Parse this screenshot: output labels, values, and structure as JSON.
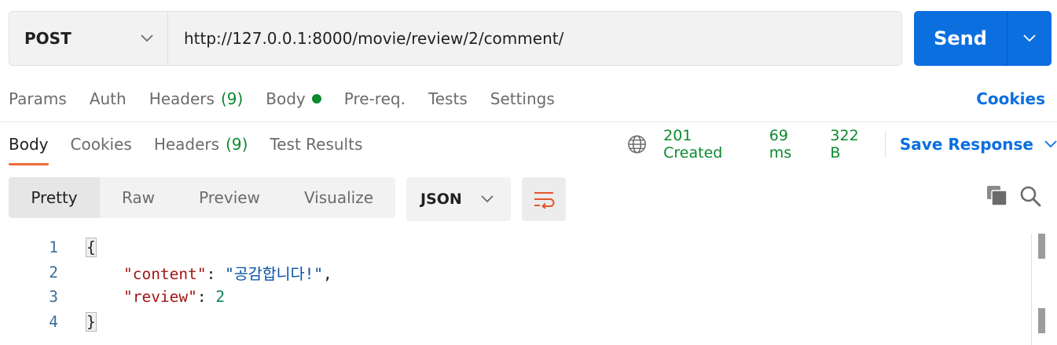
{
  "request": {
    "method": "POST",
    "url": "http://127.0.0.1:8000/movie/review/2/comment/",
    "send_label": "Send"
  },
  "request_tabs": {
    "params": "Params",
    "auth": "Auth",
    "headers": "Headers",
    "headers_count": "(9)",
    "body": "Body",
    "prereq": "Pre-req.",
    "tests": "Tests",
    "settings": "Settings",
    "cookies": "Cookies"
  },
  "response_tabs": {
    "body": "Body",
    "cookies": "Cookies",
    "headers": "Headers",
    "headers_count": "(9)",
    "test_results": "Test Results"
  },
  "status": {
    "code_text": "201 Created",
    "time": "69 ms",
    "size": "322 B",
    "save_response": "Save Response"
  },
  "format": {
    "pretty": "Pretty",
    "raw": "Raw",
    "preview": "Preview",
    "visualize": "Visualize",
    "language": "JSON"
  },
  "code": {
    "line_numbers": [
      "1",
      "2",
      "3",
      "4"
    ],
    "open_brace": "{",
    "close_brace": "}",
    "content_key": "\"content\"",
    "content_value": "\"공감합니다!\"",
    "review_key": "\"review\"",
    "review_value": "2"
  },
  "colors": {
    "accent_blue": "#0c6fe0",
    "success_green": "#0b8a2e",
    "active_tab_underline": "#f26b3a"
  }
}
